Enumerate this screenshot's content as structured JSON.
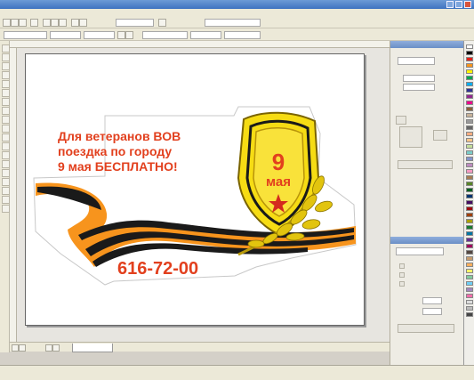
{
  "artwork": {
    "headline": [
      "Для ветеранов ВОВ",
      "поездка по городу",
      "9 мая БЕСПЛАТНО!"
    ],
    "badge_day": "9",
    "badge_month": "мая",
    "phone": "616-72-00"
  },
  "colors": {
    "accent": "#e2401e",
    "ribbon_orange": "#f7941d",
    "ribbon_black": "#1a1a1a",
    "shield_gold": "#f6dc14",
    "title_bar": "#3f73c0",
    "star": "#d42a1e"
  },
  "icons": [
    "tool-icon",
    "color-swatch",
    "window-control-icon"
  ]
}
